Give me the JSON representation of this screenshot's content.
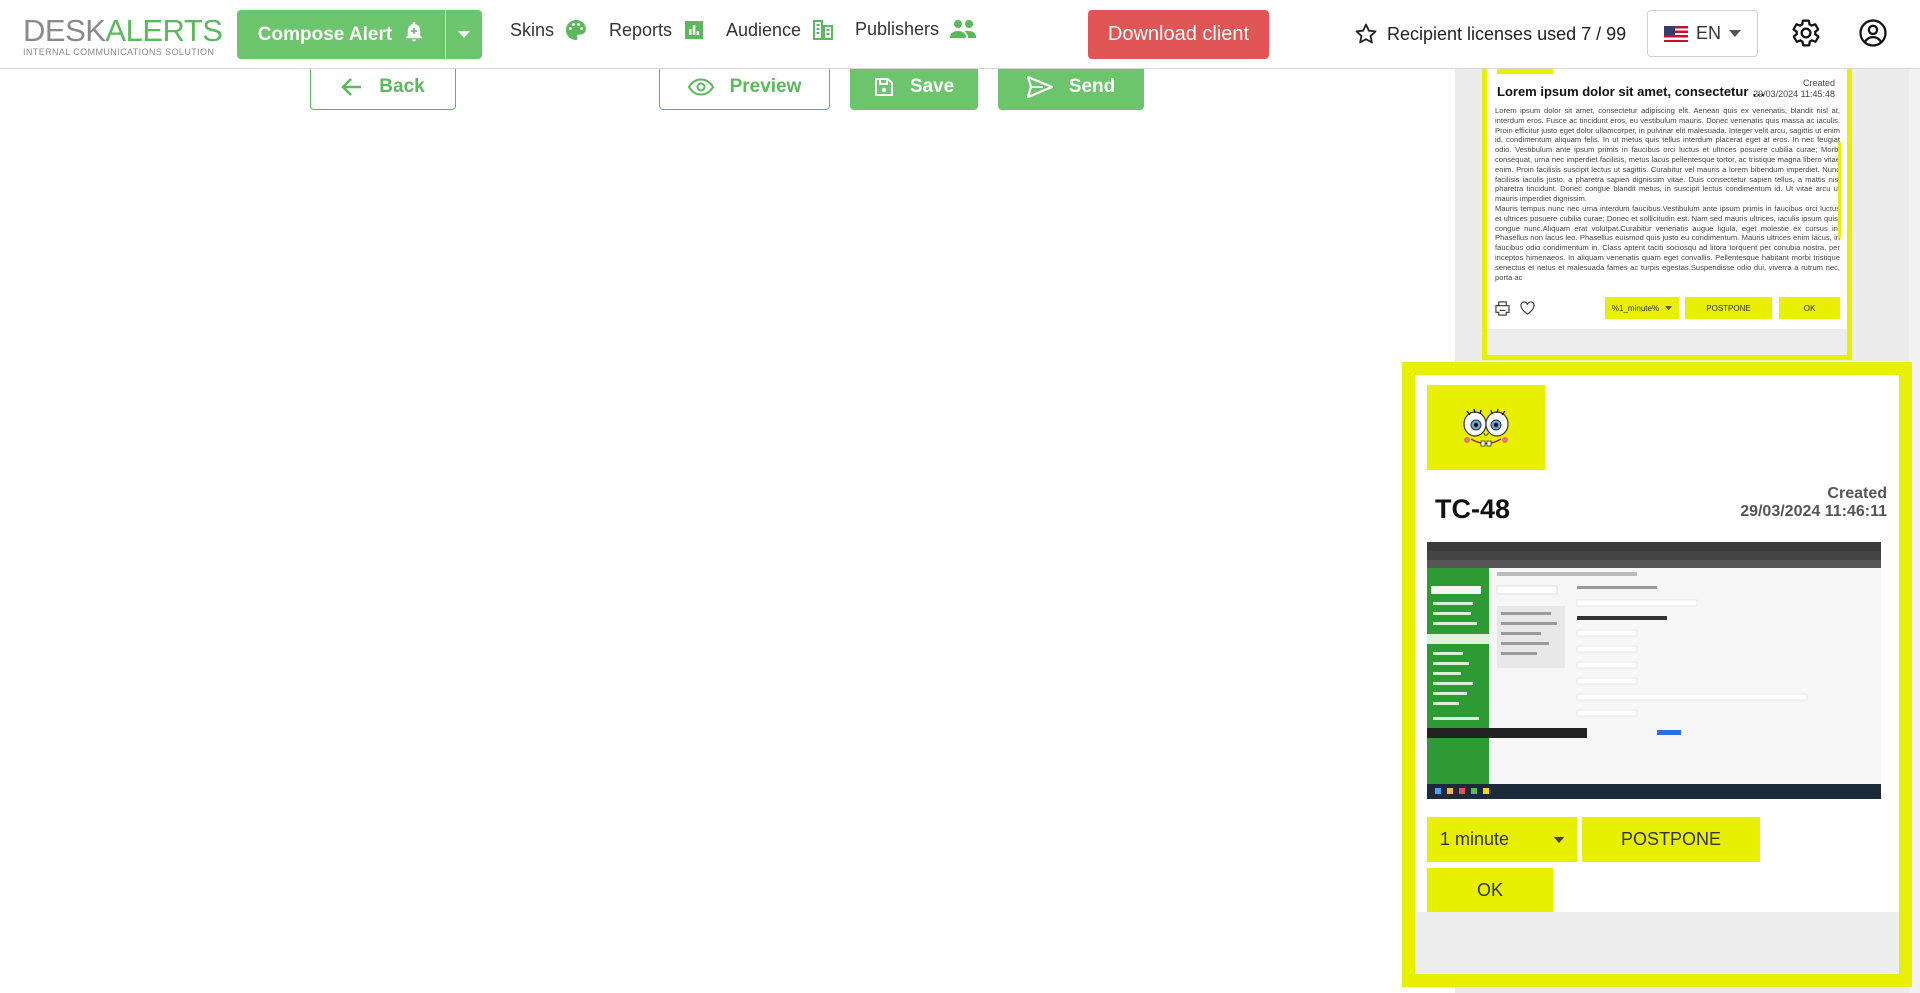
{
  "brand": {
    "logo_part1": "DESK",
    "logo_part2": "ALERTS",
    "tagline": "INTERNAL COMMUNICATIONS SOLUTION",
    "green": "#5cb85c",
    "red": "#e05555",
    "alert_yellow": "#e8f000"
  },
  "header": {
    "compose_label": "Compose Alert",
    "compose_icon": "bell-plus-icon",
    "nav": [
      {
        "label": "Skins",
        "icon": "palette-icon"
      },
      {
        "label": "Reports",
        "icon": "bar-chart-icon"
      },
      {
        "label": "Audience",
        "icon": "audience-icon"
      },
      {
        "label": "Publishers",
        "icon": "people-icon"
      }
    ],
    "download_label": "Download client",
    "licenses_label": "Recipient licenses used 7 / 99",
    "language": "EN"
  },
  "actions": {
    "back": "Back",
    "preview": "Preview",
    "save": "Save",
    "send": "Send"
  },
  "small_alert": {
    "created_label": "Created",
    "created_date": "29/03/2024 11:45:48",
    "title": "Lorem ipsum dolor sit amet, consectetur adipiscing elit",
    "body_p1": "Lorem ipsum dolor sit amet, consectetur adipiscing elit. Aenean quis ex venenatis, blandit nisl at, interdum eros. Fusce ac tincidunt eros, eu vestibulum mauris. Donec venenatis quis massa ac iaculis. Proin efficitur justo eget dolor ullamcorper, in pulvinar elit malesuada. Integer velit arcu, sagittis ut enim id, condimentum aliquam felis. In ut metus quis tellus interdum placerat eget at eros. In nec feugiat odio. Vestibulum ante ipsum primis in faucibus orci luctus et ultrices posuere cubilia curae; Morbi consequat, urna nec imperdiet facilisis, metus lacus pellentesque tortor, ac tristique magna libero vitae enim. Proin facilisis suscipit lectus ut sagittis. Curabitur vel mauris a lorem bibendum imperdiet. Nunc facilisis iaculis justo, a pharetra sapien dignissim vitae. Duis consectetur sapien tellus, a mattis nisi pharetra tincidunt. Donec congue blandit metus, in suscipit lectus condimentum id. Ut vitae arcu ut mauris imperdiet dignissim.",
    "body_p2": "Mauris tempus nunc nec urna interdum faucibus.Vestibulum ante ipsum primis in faucibus orci luctus et ultrices posuere cubilia curae; Donec et sollicitudin est. Nam sed mauris ultrices, iaculis ipsum quis, congue nunc.Aliquam erat volutpat.Curabitur venenatis augue ligula, eget molestie ex cursus in. Phasellus non lacus leo. Phasellus euismod quis justo eu condimentum. Mauris ultrices enim lacus, in faucibus odio condimentum in. Class aptent taciti sociosqu ad litora torquent per conubia nostra, per inceptos himenaeos. In aliquam venenatis quam eget convallis. Pellentesque habitant morbi tristique senectus et netus et malesuada fames ac turpis egestas.Suspendisse odio dui, viverra a rutrum nec, porta ac",
    "select_value": "%1_minute%",
    "postpone": "POSTPONE",
    "ok": "OK"
  },
  "big_alert": {
    "title": "TC-48",
    "created_label": "Created",
    "created_date": "29/03/2024 11:46:11",
    "select_value": "1 minute",
    "postpone": "POSTPONE",
    "ok": "OK"
  }
}
